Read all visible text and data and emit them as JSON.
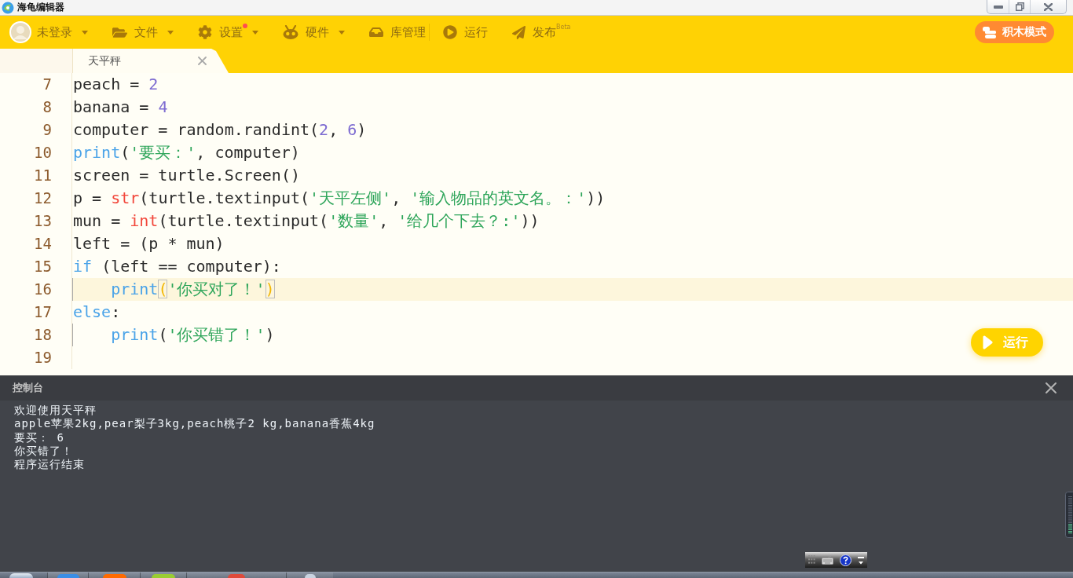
{
  "window": {
    "title": "海龟编辑器"
  },
  "toolbar": {
    "items": [
      {
        "kind": "account",
        "label": "未登录",
        "dropdown": true,
        "badge": false,
        "separator": false
      },
      {
        "kind": "file",
        "label": "文件",
        "dropdown": true,
        "badge": false,
        "separator": false
      },
      {
        "kind": "settings",
        "label": "设置",
        "dropdown": true,
        "badge": true,
        "separator": false
      },
      {
        "kind": "hardware",
        "label": "硬件",
        "dropdown": true,
        "badge": false,
        "separator": false
      },
      {
        "kind": "library",
        "label": "库管理",
        "dropdown": false,
        "badge": false,
        "separator": true
      },
      {
        "kind": "run",
        "label": "运行",
        "dropdown": false,
        "badge": false,
        "separator": false
      },
      {
        "kind": "publish",
        "label": "发布",
        "sup": "Beta",
        "dropdown": false,
        "badge": false,
        "separator": false
      }
    ],
    "mode_button": "积木模式"
  },
  "tabs": [
    {
      "label": "天平秤",
      "selected": true
    }
  ],
  "editor": {
    "lines": [
      {
        "number": "7",
        "current": false,
        "indent_guide": false,
        "tokens": [
          {
            "text": "peach = ",
            "kind": "plain"
          },
          {
            "text": "2",
            "kind": "number"
          }
        ]
      },
      {
        "number": "8",
        "current": false,
        "indent_guide": false,
        "tokens": [
          {
            "text": "banana = ",
            "kind": "plain"
          },
          {
            "text": "4",
            "kind": "number"
          }
        ]
      },
      {
        "number": "9",
        "current": false,
        "indent_guide": false,
        "tokens": [
          {
            "text": "computer = random.randint(",
            "kind": "plain"
          },
          {
            "text": "2",
            "kind": "number"
          },
          {
            "text": ", ",
            "kind": "plain"
          },
          {
            "text": "6",
            "kind": "number"
          },
          {
            "text": ")",
            "kind": "plain"
          }
        ]
      },
      {
        "number": "10",
        "current": false,
        "indent_guide": false,
        "tokens": [
          {
            "text": "print",
            "kind": "keyword"
          },
          {
            "text": "(",
            "kind": "plain"
          },
          {
            "text": "'要买：'",
            "kind": "string"
          },
          {
            "text": ", computer)",
            "kind": "plain"
          }
        ]
      },
      {
        "number": "11",
        "current": false,
        "indent_guide": false,
        "tokens": [
          {
            "text": "screen = turtle.Screen()",
            "kind": "plain"
          }
        ]
      },
      {
        "number": "12",
        "current": false,
        "indent_guide": false,
        "tokens": [
          {
            "text": "p = ",
            "kind": "plain"
          },
          {
            "text": "str",
            "kind": "type"
          },
          {
            "text": "(turtle.textinput(",
            "kind": "plain"
          },
          {
            "text": "'天平左侧'",
            "kind": "string"
          },
          {
            "text": ", ",
            "kind": "plain"
          },
          {
            "text": "'输入物品的英文名。：'",
            "kind": "string"
          },
          {
            "text": "))",
            "kind": "plain"
          }
        ]
      },
      {
        "number": "13",
        "current": false,
        "indent_guide": false,
        "tokens": [
          {
            "text": "mun = ",
            "kind": "plain"
          },
          {
            "text": "int",
            "kind": "type"
          },
          {
            "text": "(turtle.textinput(",
            "kind": "plain"
          },
          {
            "text": "'数量'",
            "kind": "string"
          },
          {
            "text": ", ",
            "kind": "plain"
          },
          {
            "text": "'给几个下去？:'",
            "kind": "string"
          },
          {
            "text": "))",
            "kind": "plain"
          }
        ]
      },
      {
        "number": "14",
        "current": false,
        "indent_guide": false,
        "tokens": [
          {
            "text": "left = (p * mun)",
            "kind": "plain"
          }
        ]
      },
      {
        "number": "15",
        "current": false,
        "indent_guide": false,
        "tokens": [
          {
            "text": "if",
            "kind": "keyword"
          },
          {
            "text": " (left == computer):",
            "kind": "plain"
          }
        ]
      },
      {
        "number": "16",
        "current": true,
        "indent_guide": true,
        "tokens": [
          {
            "text": "    print",
            "kind": "keyword"
          },
          {
            "text": "(",
            "kind": "bracket"
          },
          {
            "text": "'你买对了！'",
            "kind": "string"
          },
          {
            "text": ")",
            "kind": "bracket"
          }
        ]
      },
      {
        "number": "17",
        "current": false,
        "indent_guide": false,
        "tokens": [
          {
            "text": "else",
            "kind": "keyword"
          },
          {
            "text": ":",
            "kind": "plain"
          }
        ]
      },
      {
        "number": "18",
        "current": false,
        "indent_guide": true,
        "tokens": [
          {
            "text": "    print",
            "kind": "keyword"
          },
          {
            "text": "(",
            "kind": "plain"
          },
          {
            "text": "'你买错了！'",
            "kind": "string"
          },
          {
            "text": ")",
            "kind": "plain"
          }
        ]
      },
      {
        "number": "19",
        "current": false,
        "indent_guide": false
      }
    ]
  },
  "run_button": "运行",
  "console": {
    "title": "控制台",
    "lines": [
      "欢迎使用天平秤",
      "apple苹果2kg,pear梨子3kg,peach桃子2 kg,banana香蕉4kg",
      "要买： 6",
      "你买错了！",
      "程序运行结束"
    ]
  }
}
